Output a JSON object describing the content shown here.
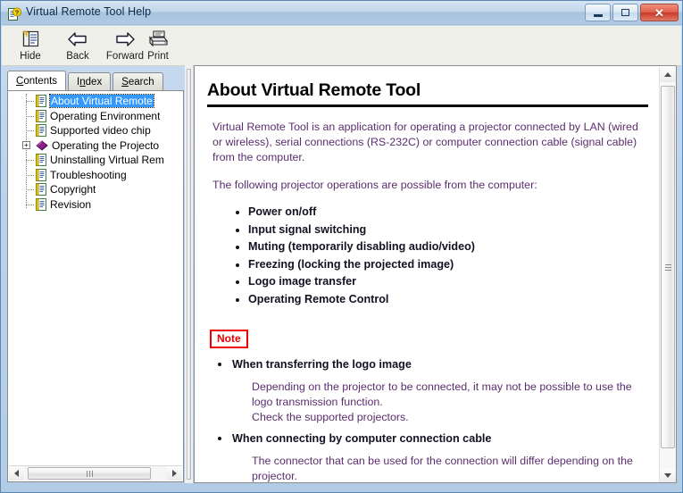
{
  "window": {
    "title": "Virtual Remote Tool Help",
    "icon": "help-document-icon",
    "buttons": {
      "minimize": "minimize-button",
      "maximize": "maximize-button",
      "close": "close-button"
    }
  },
  "toolbar": {
    "items": [
      {
        "label": "Hide",
        "icon": "hide-pane-icon"
      },
      {
        "label": "Back",
        "icon": "arrow-left-icon"
      },
      {
        "label": "Forward",
        "icon": "arrow-right-icon"
      },
      {
        "label": "Print",
        "icon": "printer-icon"
      }
    ]
  },
  "tabs": [
    {
      "label": "Contents",
      "accesskey": "C",
      "rest": "ontents",
      "active": true
    },
    {
      "label": "Index",
      "accesskey": "I",
      "pre": "I",
      "rest": "ndex",
      "active": false
    },
    {
      "label": "Search",
      "accesskey": "S",
      "rest": "earch",
      "active": false
    }
  ],
  "tree": {
    "items": [
      {
        "label": "About Virtual Remote",
        "icon": "page-icon",
        "selected": true,
        "expander": null
      },
      {
        "label": "Operating Environment",
        "icon": "page-icon",
        "selected": false,
        "expander": null
      },
      {
        "label": "Supported video chip",
        "icon": "page-icon",
        "selected": false,
        "expander": null
      },
      {
        "label": "Operating the Projecto",
        "icon": "book-icon",
        "selected": false,
        "expander": "+"
      },
      {
        "label": "Uninstalling Virtual Rem",
        "icon": "page-icon",
        "selected": false,
        "expander": null
      },
      {
        "label": "Troubleshooting",
        "icon": "page-icon",
        "selected": false,
        "expander": null
      },
      {
        "label": "Copyright",
        "icon": "page-icon",
        "selected": false,
        "expander": null
      },
      {
        "label": "Revision",
        "icon": "page-icon",
        "selected": false,
        "expander": null
      }
    ]
  },
  "document": {
    "title": "About Virtual Remote Tool",
    "intro_1": "Virtual Remote Tool is an application for operating a projector connected by LAN (wired or wireless), serial connections (RS-232C) or computer connection cable (signal cable) from the computer.",
    "intro_2": "The following projector operations are possible from the computer:",
    "operations": [
      "Power on/off",
      "Input signal switching",
      "Muting (temporarily disabling audio/video)",
      "Freezing (locking the projected image)",
      "Logo image transfer",
      "Operating Remote Control"
    ],
    "note_label": "Note",
    "notes": [
      {
        "heading": "When transferring the logo image",
        "body": "Depending on the projector to be connected, it may not be possible to use the logo transmission function.\nCheck the supported projectors."
      },
      {
        "heading": "When connecting by computer connection cable",
        "body": "The connector that can be used for the connection will differ depending on the projector.\nIt may not be able to communicate with the projector because the graphics"
      }
    ]
  },
  "colors": {
    "selection": "#3399ff",
    "note_red": "#ee0000",
    "body_purple": "#5c2d6e",
    "titlebar_blue": "#b2cae3"
  }
}
